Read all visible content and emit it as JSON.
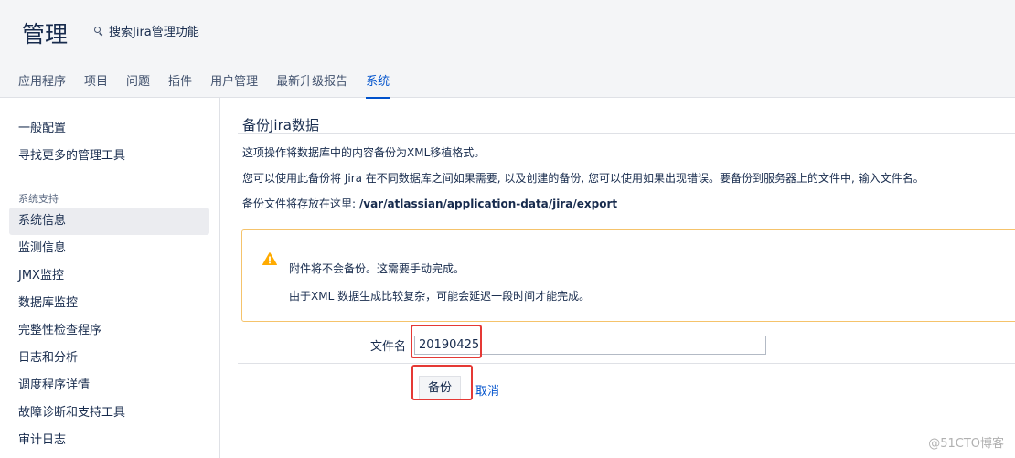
{
  "header": {
    "title": "管理",
    "search_label": "搜索Jira管理功能",
    "tabs": [
      {
        "label": "应用程序"
      },
      {
        "label": "项目"
      },
      {
        "label": "问题"
      },
      {
        "label": "插件"
      },
      {
        "label": "用户管理"
      },
      {
        "label": "最新升级报告"
      },
      {
        "label": "系统",
        "active": true
      }
    ]
  },
  "sidebar": {
    "top_items": [
      {
        "label": "一般配置"
      },
      {
        "label": "寻找更多的管理工具"
      }
    ],
    "section_heading": "系统支持",
    "items": [
      {
        "label": "系统信息",
        "selected": true
      },
      {
        "label": "监测信息"
      },
      {
        "label": "JMX监控"
      },
      {
        "label": "数据库监控"
      },
      {
        "label": "完整性检查程序"
      },
      {
        "label": "日志和分析"
      },
      {
        "label": "调度程序详情"
      },
      {
        "label": "故障诊断和支持工具"
      },
      {
        "label": "审计日志"
      }
    ]
  },
  "main": {
    "title": "备份Jira数据",
    "desc1": "这项操作将数据库中的内容备份为XML移植格式。",
    "desc2": "您可以使用此备份将 Jira 在不同数据库之间如果需要, 以及创建的备份, 您可以使用如果出现错误。要备份到服务器上的文件中, 输入文件名。",
    "path_prefix": "备份文件将存放在这里: ",
    "path": "/var/atlassian/application-data/jira/export",
    "warning": {
      "line1": "附件将不会备份。这需要手动完成。",
      "line2": "由于XML 数据生成比较复杂，可能会延迟一段时间才能完成。"
    },
    "form": {
      "filename_label": "文件名",
      "filename_value": "20190425",
      "backup_button": "备份",
      "cancel_link": "取消"
    }
  },
  "watermark": "@51CTO博客",
  "colors": {
    "accent": "#0052cc",
    "warning_border": "#f5c36b",
    "warning_icon": "#ffab00",
    "highlight": "#e53935"
  }
}
